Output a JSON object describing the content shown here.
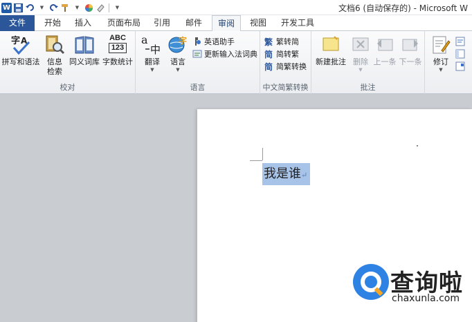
{
  "window": {
    "title": "文档6 (自动保存的) - Microsoft W"
  },
  "quick_access": [
    {
      "icon": "word-logo-icon",
      "label": "W"
    },
    {
      "icon": "save-icon"
    },
    {
      "icon": "undo-icon"
    },
    {
      "icon": "redo-icon"
    },
    {
      "icon": "format-painter-icon"
    },
    {
      "icon": "color-wheel-icon"
    },
    {
      "icon": "eraser-icon"
    },
    {
      "icon": "customize-qat-icon"
    }
  ],
  "tabs": {
    "file": "文件",
    "home": "开始",
    "insert": "插入",
    "layout": "页面布局",
    "references": "引用",
    "mailings": "邮件",
    "review": "审阅",
    "view": "视图",
    "developer": "开发工具"
  },
  "ribbon": {
    "proofing": {
      "label": "校对",
      "spelling": "拼写和语法",
      "research_line1": "信息",
      "research_line2": "检索",
      "thesaurus": "同义词库",
      "word_count": "字数统计",
      "abc_line1": "ABC",
      "abc_line2": "123"
    },
    "language": {
      "label": "语言",
      "translate": "翻译",
      "language": "语言",
      "english_assistant": "英语助手",
      "update_ime": "更新输入法词典"
    },
    "chinese_conversion": {
      "label": "中文简繁转换",
      "to_simplified": "繁转简",
      "to_traditional": "简转繁",
      "convert": "简繁转换"
    },
    "comments": {
      "label": "批注",
      "new_comment": "新建批注",
      "delete": "删除",
      "previous": "上一条",
      "next": "下一条"
    },
    "tracking": {
      "track_changes": "修订"
    }
  },
  "document": {
    "selected_text": "我是谁",
    "paragraph_mark": "↵"
  },
  "watermark": {
    "brand_cn": "查询啦",
    "url": "chaxunla.com"
  },
  "colors": {
    "file_tab": "#2b579a",
    "selection": "#a8c3e8",
    "watermark_blue": "#2d82e3"
  }
}
